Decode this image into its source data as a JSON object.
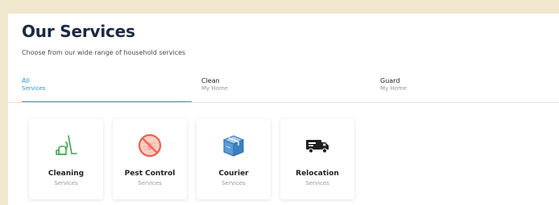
{
  "header": {
    "title": "Our Services",
    "subtitle": "Choose from our wide range of household services"
  },
  "tabs": [
    {
      "line1": "All",
      "line2": "Services",
      "active": true
    },
    {
      "line1": "Clean",
      "line2": "My Home",
      "active": false
    },
    {
      "line1": "Guard",
      "line2": "My Home",
      "active": false
    }
  ],
  "services": [
    {
      "label": "Cleaning",
      "sub": "Services",
      "icon": "vacuum-cleaner-icon"
    },
    {
      "label": "Pest Control",
      "sub": "Services",
      "icon": "no-pest-icon"
    },
    {
      "label": "Courier",
      "sub": "Services",
      "icon": "package-box-icon"
    },
    {
      "label": "Relocation",
      "sub": "Services",
      "icon": "moving-truck-icon"
    }
  ],
  "colors": {
    "accent": "#2a9bd3",
    "background": "#f1e7cf",
    "title": "#1a2a45",
    "cleaning_icon": "#3aa64a",
    "pest_icon": "#f0604d",
    "courier_icon": "#5b9bd5"
  }
}
